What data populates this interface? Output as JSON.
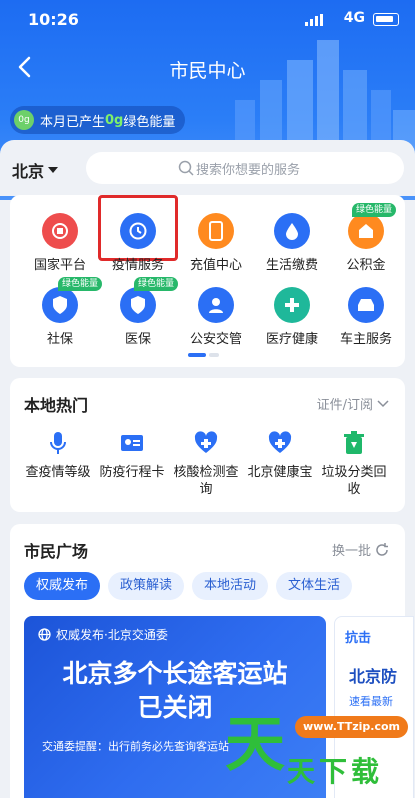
{
  "status_bar": {
    "time": "10:26",
    "network": "4G"
  },
  "header": {
    "title": "市民中心",
    "energy_prefix": "本月已产生",
    "energy_value": "0g",
    "energy_suffix": "绿色能量",
    "energy_badge": "0g"
  },
  "search": {
    "city": "北京",
    "placeholder": "搜索你想要的服务"
  },
  "services": [
    {
      "label": "国家平台",
      "icon": "national-emblem-icon",
      "color": "#ee4d4d"
    },
    {
      "label": "疫情服务",
      "icon": "clock-history-icon",
      "color": "#2b6ff5"
    },
    {
      "label": "充值中心",
      "icon": "phone-icon",
      "color": "#ff8a1f"
    },
    {
      "label": "生活缴费",
      "icon": "water-drop-icon",
      "color": "#2b6ff5"
    },
    {
      "label": "公积金",
      "icon": "house-money-icon",
      "color": "#ff8a1f",
      "tag": "绿色能量"
    },
    {
      "label": "社保",
      "icon": "shield-social-icon",
      "color": "#2b6ff5",
      "tag": "绿色能量"
    },
    {
      "label": "医保",
      "icon": "shield-medical-icon",
      "color": "#2b6ff5",
      "tag": "绿色能量"
    },
    {
      "label": "公安交管",
      "icon": "police-icon",
      "color": "#2b6ff5"
    },
    {
      "label": "医疗健康",
      "icon": "medical-cross-icon",
      "color": "#1fb89a"
    },
    {
      "label": "车主服务",
      "icon": "car-icon",
      "color": "#2b6ff5"
    }
  ],
  "hot": {
    "title": "本地热门",
    "right_label": "证件/订阅",
    "items": [
      {
        "label": "查疫情等级",
        "icon": "microphone-icon",
        "color": "#2b6ff5"
      },
      {
        "label": "防疫行程卡",
        "icon": "id-card-icon",
        "color": "#2b6ff5"
      },
      {
        "label": "核酸检测查询",
        "icon": "heart-plus-icon",
        "color": "#2b6ff5"
      },
      {
        "label": "北京健康宝",
        "icon": "heart-plus-icon",
        "color": "#2b6ff5"
      },
      {
        "label": "垃圾分类回收",
        "icon": "recycle-bin-icon",
        "color": "#1fb86a"
      }
    ]
  },
  "plaza": {
    "title": "市民广场",
    "refresh_label": "换一批",
    "tabs": [
      "权威发布",
      "政策解读",
      "本地活动",
      "文体生活"
    ],
    "banner": {
      "source": "权威发布·北京交通委",
      "headline_line1": "北京多个长途客运站",
      "headline_line2": "已关闭",
      "note": "交通委提醒：出行前务必先查询客运站"
    },
    "banner2": {
      "header": "抗击",
      "line1": "北京防",
      "line2": "速看最新"
    }
  },
  "watermark": {
    "url": "www.TTzip.com",
    "big": "天",
    "text": "天下载"
  }
}
